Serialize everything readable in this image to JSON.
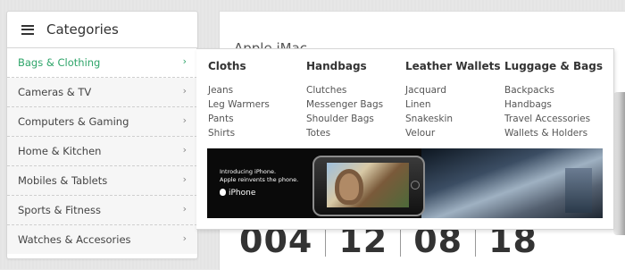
{
  "sidebar": {
    "title": "Categories",
    "items": [
      {
        "label": "Bags & Clothing",
        "active": true
      },
      {
        "label": "Cameras & TV"
      },
      {
        "label": "Computers & Gaming"
      },
      {
        "label": "Home & Kitchen"
      },
      {
        "label": "Mobiles & Tablets"
      },
      {
        "label": "Sports & Fitness"
      },
      {
        "label": "Watches & Accesories"
      }
    ],
    "chevron": "›",
    "active_color": "#2fa56a"
  },
  "mega_menu": {
    "columns": [
      {
        "heading": "Cloths",
        "links": [
          "Jeans",
          "Leg Warmers",
          "Pants",
          "Shirts"
        ]
      },
      {
        "heading": "Handbags",
        "links": [
          "Clutches",
          "Messenger Bags",
          "Shoulder Bags",
          "Totes"
        ]
      },
      {
        "heading": "Leather Wallets",
        "links": [
          "Jacquard",
          "Linen",
          "Snakeskin",
          "Velour"
        ]
      },
      {
        "heading": "Luggage & Bags",
        "links": [
          "Backpacks",
          "Handbags",
          "Travel Accessories",
          "Wallets & Holders"
        ]
      }
    ],
    "banner": {
      "line1": "Introducing iPhone.",
      "line2": "Apple reinvents the phone.",
      "brand": "iPhone"
    }
  },
  "product": {
    "title": "Apple iMac",
    "countdown": [
      "004",
      "12",
      "08",
      "18"
    ]
  }
}
